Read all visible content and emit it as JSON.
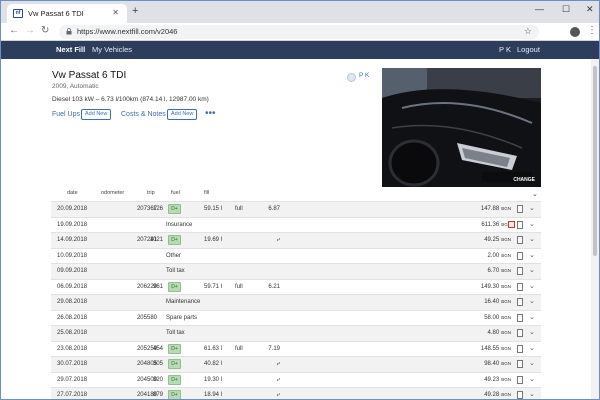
{
  "browser": {
    "tab_title": "Vw Passat 6 TDI",
    "favicon_text": "nf",
    "url": "https://www.nextfill.com/v2046",
    "controls": {
      "minimize": "—",
      "maximize": "☐",
      "close": "✕"
    }
  },
  "site": {
    "brand": "Next Fill",
    "nav_vehicles": "My Vehicles",
    "user": "P K",
    "logout": "Logout"
  },
  "vehicle": {
    "title": "Vw Passat 6 TDI",
    "subtitle": "2009, Automatic",
    "spec": "Diesel 103 kW – 6.73 l/100km (874.14 l, 12987.00 km)",
    "owner": "P K",
    "photo_change_label": "CHANGE"
  },
  "sections": {
    "fuel_ups": "Fuel Ups",
    "costs_notes": "Costs & Notes",
    "add_new": "Add New",
    "more": "•••"
  },
  "table": {
    "headers": {
      "date": "date",
      "odometer": "odometer",
      "trip": "trip",
      "fuel": "fuel",
      "fill": "fill"
    },
    "badge_label": "D+",
    "currency": "BGN",
    "rows": [
      {
        "date": "20.09.2018",
        "odo": "207367",
        "trip": "126",
        "fuel": true,
        "fill": "59.15 l",
        "full": "full",
        "cons": "6.87",
        "amount": "147.88"
      },
      {
        "date": "19.09.2018",
        "odo": "",
        "trip": "",
        "fuel": false,
        "desc": "Insurance",
        "amount": "611.36",
        "warn": true
      },
      {
        "date": "14.09.2018",
        "odo": "207241",
        "trip": "1021",
        "fuel": true,
        "fill": "19.69 l",
        "full": "",
        "cons": "⤶",
        "amount": "49.25"
      },
      {
        "date": "10.09.2018",
        "odo": "",
        "trip": "",
        "fuel": false,
        "desc": "Other",
        "amount": "2.00"
      },
      {
        "date": "09.09.2018",
        "odo": "",
        "trip": "",
        "fuel": false,
        "desc": "Toll tax",
        "amount": "6.70"
      },
      {
        "date": "06.09.2018",
        "odo": "206220",
        "trip": "961",
        "fuel": true,
        "fill": "59.71 l",
        "full": "full",
        "cons": "6.21",
        "amount": "149.30"
      },
      {
        "date": "29.08.2018",
        "odo": "",
        "trip": "",
        "fuel": false,
        "desc": "Maintenance",
        "amount": "16.40"
      },
      {
        "date": "26.08.2018",
        "odo": "205580",
        "trip": "",
        "fuel": false,
        "desc": "Spare parts",
        "amount": "58.00"
      },
      {
        "date": "25.08.2018",
        "odo": "",
        "trip": "",
        "fuel": false,
        "desc": "Toll tax",
        "amount": "4.80"
      },
      {
        "date": "23.08.2018",
        "odo": "205259",
        "trip": "454",
        "fuel": true,
        "fill": "61.63 l",
        "full": "full",
        "cons": "7.19",
        "amount": "148.55"
      },
      {
        "date": "30.07.2018",
        "odo": "204805",
        "trip": "305",
        "fuel": true,
        "fill": "40.82 l",
        "full": "",
        "cons": "⤶",
        "amount": "98.40"
      },
      {
        "date": "29.07.2018",
        "odo": "204500",
        "trip": "320",
        "fuel": true,
        "fill": "19.30 l",
        "full": "",
        "cons": "⤶",
        "amount": "49.23"
      },
      {
        "date": "27.07.2018",
        "odo": "204180",
        "trip": "879",
        "fuel": true,
        "fill": "18.94 l",
        "full": "",
        "cons": "⤶",
        "amount": "49.28"
      }
    ]
  }
}
